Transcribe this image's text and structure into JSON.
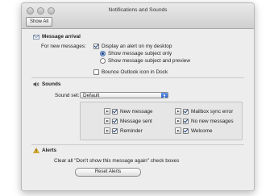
{
  "window": {
    "title": "Notifications and Sounds"
  },
  "toolbar": {
    "show_all_label": "Show All"
  },
  "message_arrival": {
    "heading": "Message arrival",
    "for_new_label": "For new messages:",
    "display_alert_label": "Display an alert on my desktop",
    "show_subject_only_label": "Show message subject only",
    "show_subject_preview_label": "Show message subject and preview",
    "bounce_label": "Bounce Outlook icon in Dock"
  },
  "sounds": {
    "heading": "Sounds",
    "sound_set_label": "Sound set:",
    "sound_set_value": "Default",
    "items_left": [
      {
        "label": "New message"
      },
      {
        "label": "Message sent"
      },
      {
        "label": "Reminder"
      }
    ],
    "items_right": [
      {
        "label": "Mailbox sync error"
      },
      {
        "label": "No new messages"
      },
      {
        "label": "Welcome"
      }
    ]
  },
  "alerts": {
    "heading": "Alerts",
    "clear_text": "Clear all \"Don't show this message again\" check boxes",
    "reset_label": "Reset Alerts"
  }
}
